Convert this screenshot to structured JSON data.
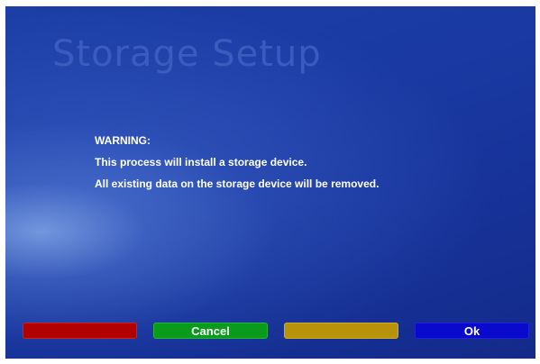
{
  "screen": {
    "title": "Storage Setup"
  },
  "message": {
    "lines": [
      "WARNING:",
      "This process will install a storage device.",
      "All existing data on the storage device will be removed."
    ]
  },
  "buttons": {
    "red": {
      "label": "",
      "color": "#b00000"
    },
    "green": {
      "label": "Cancel",
      "color": "#0a9a1c"
    },
    "yellow": {
      "label": "",
      "color": "#b8920a"
    },
    "blue": {
      "label": "Ok",
      "color": "#0a0acc"
    }
  }
}
